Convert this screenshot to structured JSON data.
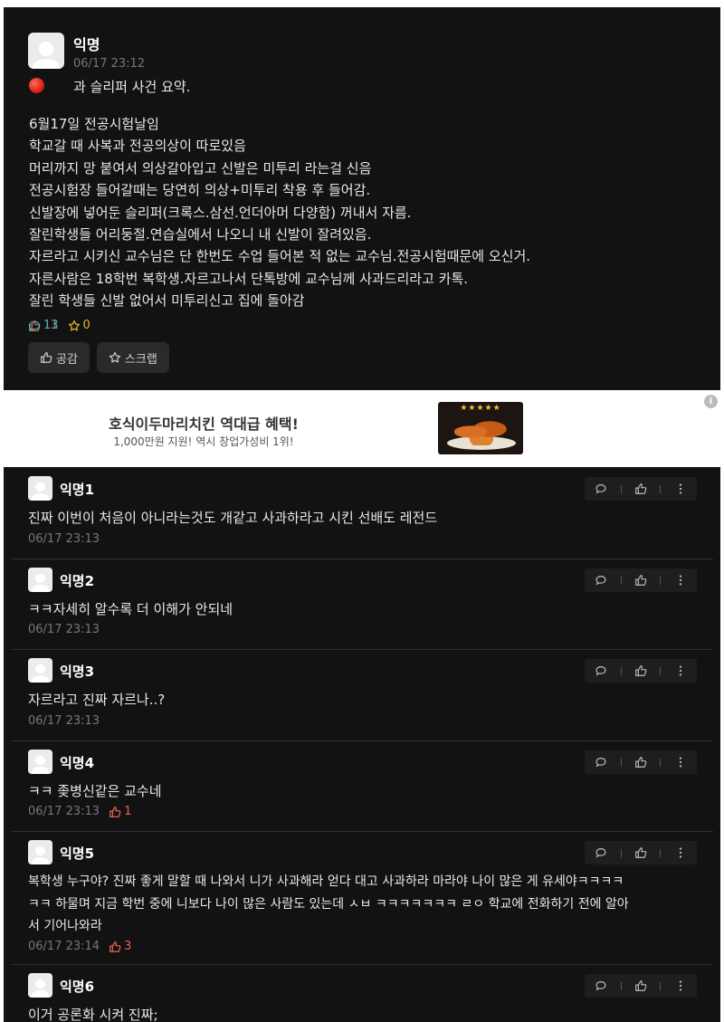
{
  "post": {
    "author": "익명",
    "time": "06/17 23:12",
    "subject": "과 슬리퍼 사건 요약.",
    "body": [
      "6월17일 전공시험날임",
      "학교갈 때 사복과 전공의상이 따로있음",
      "머리까지 망 붙여서 의상갈아입고 신발은 미투리 라는걸 신음",
      "전공시험장 들어갈때는 당연히 의상+미투리 착용 후 들어감.",
      "신발장에 넣어둔 슬리퍼(크록스.삼선.언더아머 다양함) 꺼내서 자름.",
      "잘린학생들 어리둥절.연습실에서 나오니 내 신발이 잘려있음.",
      "자르라고 시키신 교수님은 단 한번도 수업 들어본 적 없는 교수님.전공시험때문에 오신거.",
      "자른사람은 18학번 복학생.자르고나서 단톡방에 교수님께 사과드리라고 카톡.",
      "잘린 학생들 신발 없어서 미투리신고 집에 돌아감"
    ],
    "stats": {
      "likes": "11",
      "comments": "13",
      "scraps": "0"
    },
    "buttons": {
      "like": "공감",
      "scrap": "스크랩"
    },
    "icons": {
      "subject": "red-circle-icon",
      "like": "thumbs-up-icon",
      "comment": "speech-bubble-icon",
      "scrap": "star-icon"
    }
  },
  "ad": {
    "title": "호식이두마리치킨 역대급 혜택!",
    "subtitle": "1,000만원 지원! 역시 창업가성비 1위!",
    "stars": "★★★★★",
    "info_symbol": "i"
  },
  "comments": [
    {
      "author": "익명1",
      "lines": [
        "진짜 이번이 처음이 아니라는것도 개같고 사과하라고 시킨 선배도 레전드"
      ],
      "time": "06/17 23:13",
      "likes": ""
    },
    {
      "author": "익명2",
      "lines": [
        "ㅋㅋ자세히 알수록 더 이해가 안되네"
      ],
      "time": "06/17 23:13",
      "likes": ""
    },
    {
      "author": "익명3",
      "lines": [
        "자르라고 진짜 자르나..?"
      ],
      "time": "06/17 23:13",
      "likes": ""
    },
    {
      "author": "익명4",
      "lines": [
        "ㅋㅋ 좆병신같은 교수네"
      ],
      "time": "06/17 23:13",
      "likes": "1"
    },
    {
      "author": "익명5",
      "lines": [
        "복학생 누구야? 진짜 좋게 말할 때 나와서 니가 사과해라 얻다 대고 사과하라 마라야 나이 많은 게 유세야ㅋㅋㅋㅋ",
        "ㅋㅋ 하물며 지금 학번 중에 니보다 나이 많은 사람도 있는데 ㅅㅂ ㅋㅋㅋㅋㅋㅋㅋ ㄹㅇ 학교에 전화하기 전에 알아",
        "서 기어나와라"
      ],
      "time": "06/17 23:14",
      "likes": "3"
    },
    {
      "author": "익명6",
      "lines": [
        "이거 공론화 시켜 진짜;"
      ],
      "time": "",
      "likes": ""
    }
  ],
  "colors": {
    "background": "#121212",
    "text": "#e8e8e8",
    "muted": "#777777",
    "like": "#e8644f",
    "comment": "#34b4c8",
    "scrap": "#e3b72f"
  }
}
